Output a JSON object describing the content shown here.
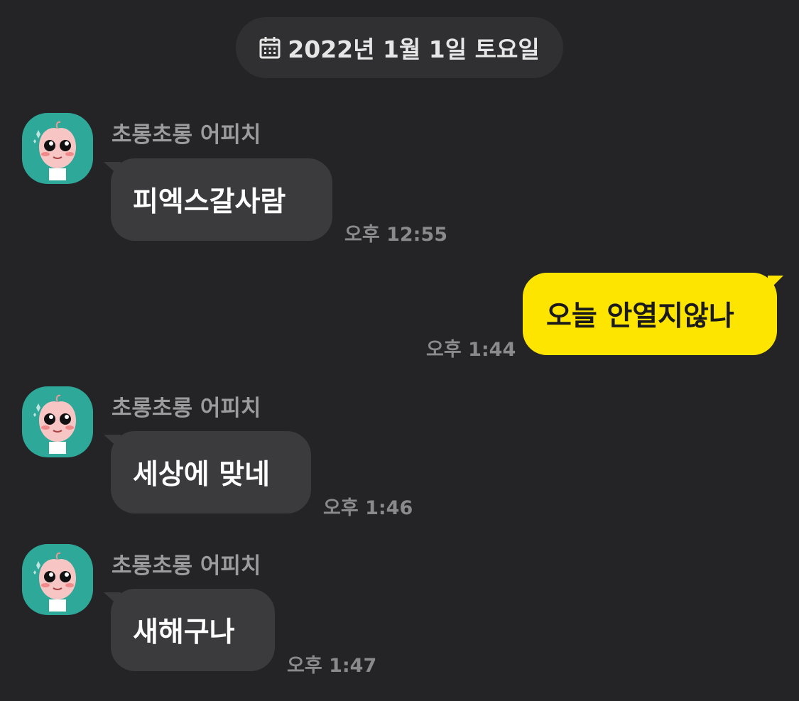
{
  "date_divider": {
    "icon": "calendar-icon",
    "label": "2022년 1월 1일 토요일"
  },
  "colors": {
    "background": "#242427",
    "incoming_bubble": "#3b3b3e",
    "outgoing_bubble": "#fee500",
    "avatar_bg": "#2ea898"
  },
  "messages": [
    {
      "direction": "incoming",
      "sender": "초롱초롱 어피치",
      "avatar_icon": "apeach-avatar-icon",
      "text": "피엑스갈사람",
      "time": "오후 12:55"
    },
    {
      "direction": "outgoing",
      "text": "오늘 안열지않나",
      "time": "오후 1:44"
    },
    {
      "direction": "incoming",
      "sender": "초롱초롱 어피치",
      "avatar_icon": "apeach-avatar-icon",
      "text": "세상에 맞네",
      "time": "오후 1:46"
    },
    {
      "direction": "incoming",
      "sender": "초롱초롱 어피치",
      "avatar_icon": "apeach-avatar-icon",
      "text": "새해구나",
      "time": "오후 1:47"
    }
  ]
}
